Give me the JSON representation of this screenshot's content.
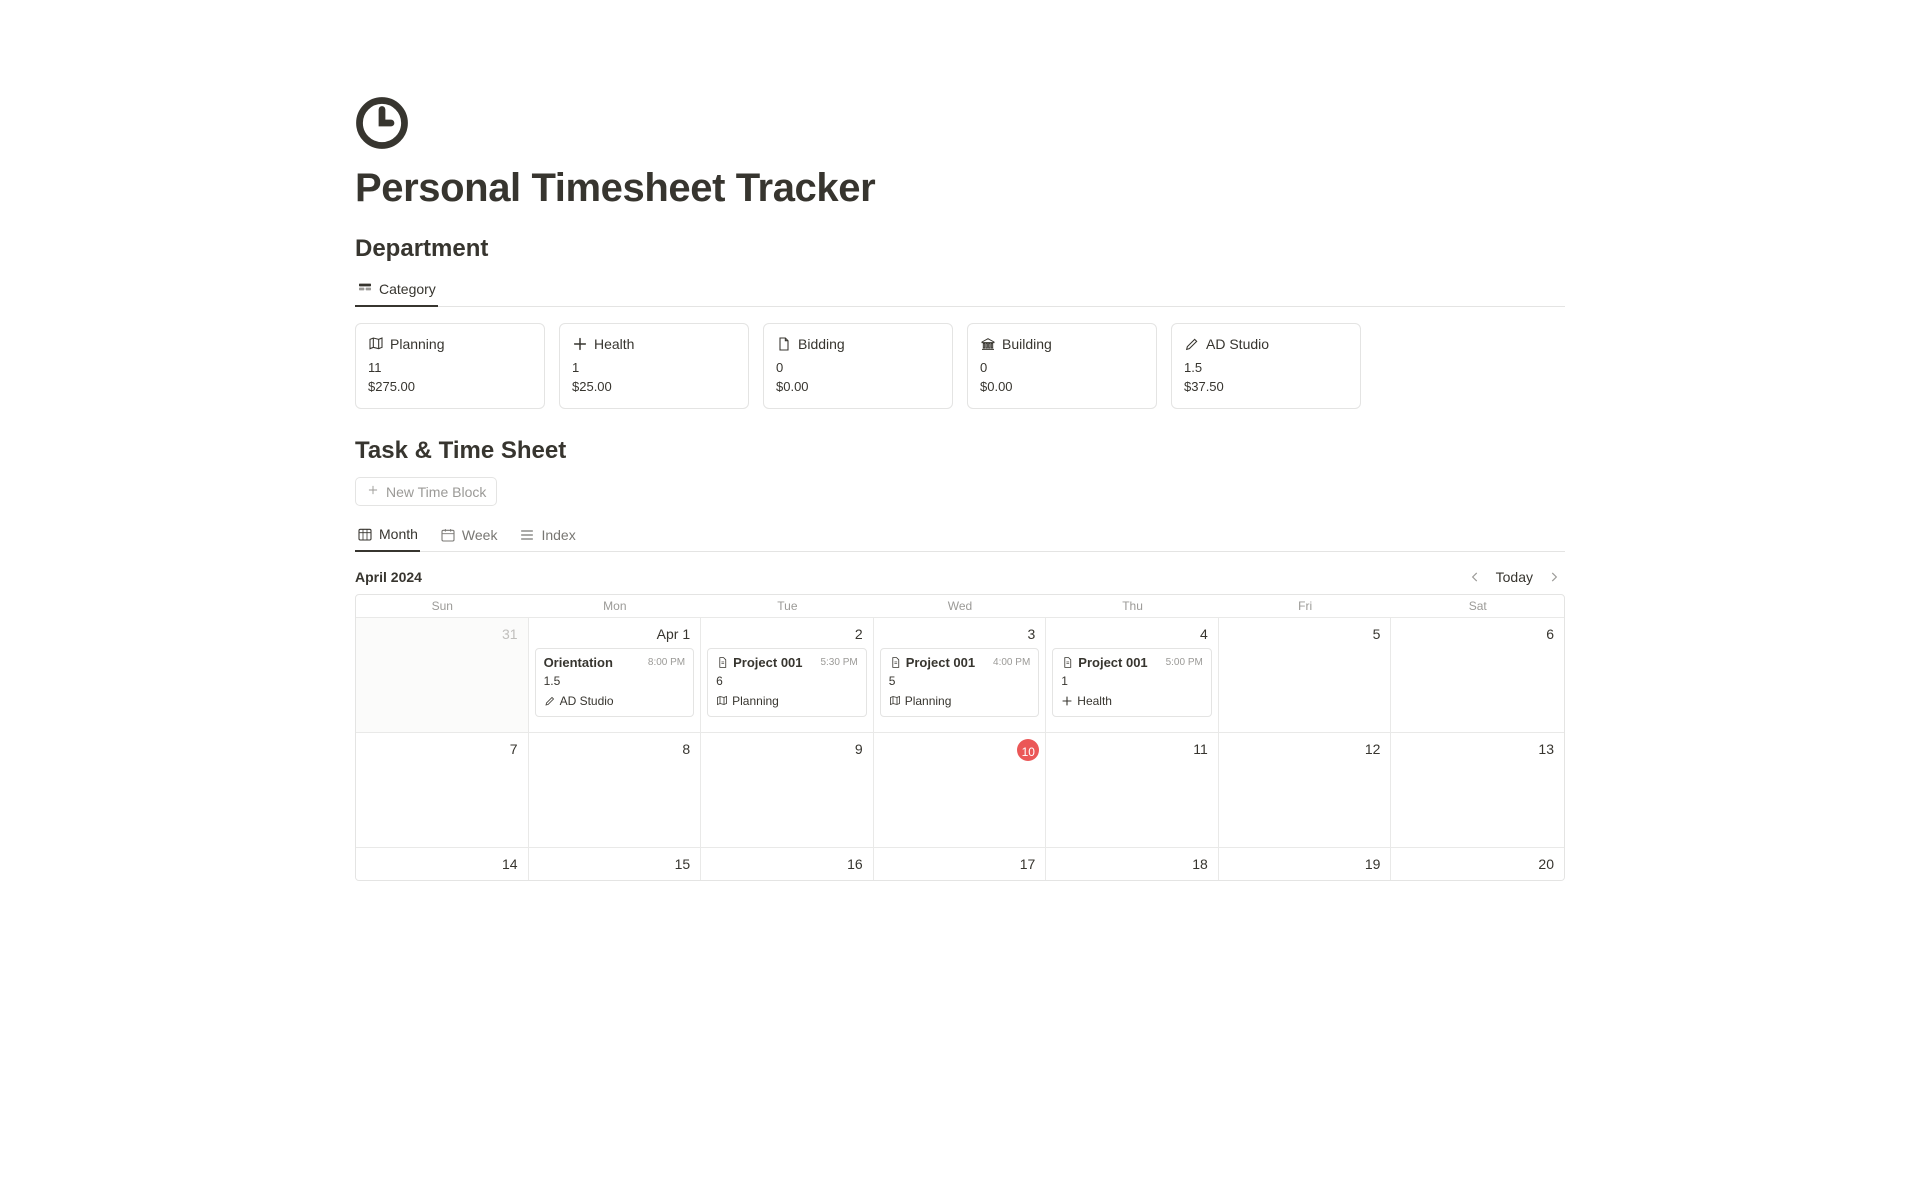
{
  "pageTitle": "Personal Timesheet Tracker",
  "section1": {
    "title": "Department",
    "tab": "Category"
  },
  "cards": [
    {
      "icon": "map",
      "name": "Planning",
      "hours": "11",
      "amount": "$275.00"
    },
    {
      "icon": "plus",
      "name": "Health",
      "hours": "1",
      "amount": "$25.00"
    },
    {
      "icon": "file",
      "name": "Bidding",
      "hours": "0",
      "amount": "$0.00"
    },
    {
      "icon": "bank",
      "name": "Building",
      "hours": "0",
      "amount": "$0.00"
    },
    {
      "icon": "pencil",
      "name": "AD Studio",
      "hours": "1.5",
      "amount": "$37.50"
    }
  ],
  "section2": {
    "title": "Task & Time Sheet",
    "newBtn": "New Time Block"
  },
  "calTabs": [
    {
      "icon": "cal-grid",
      "label": "Month",
      "active": true
    },
    {
      "icon": "cal-week",
      "label": "Week",
      "active": false
    },
    {
      "icon": "list",
      "label": "Index",
      "active": false
    }
  ],
  "calendar": {
    "month": "April 2024",
    "today": "Today",
    "dow": [
      "Sun",
      "Mon",
      "Tue",
      "Wed",
      "Thu",
      "Fri",
      "Sat"
    ],
    "row1": {
      "dates": [
        "31",
        "Apr 1",
        "2",
        "3",
        "4",
        "5",
        "6"
      ],
      "otherMonth": [
        true,
        false,
        false,
        false,
        false,
        false,
        false
      ],
      "events": {
        "1": {
          "title": "Orientation",
          "time": "8:00 PM",
          "hours": "1.5",
          "tagIcon": "pencil",
          "tag": "AD Studio",
          "doc": false
        },
        "2": {
          "title": "Project 001",
          "time": "5:30 PM",
          "hours": "6",
          "tagIcon": "map",
          "tag": "Planning",
          "doc": true
        },
        "3": {
          "title": "Project 001",
          "time": "4:00 PM",
          "hours": "5",
          "tagIcon": "map",
          "tag": "Planning",
          "doc": true
        },
        "4": {
          "title": "Project 001",
          "time": "5:00 PM",
          "hours": "1",
          "tagIcon": "plus",
          "tag": "Health",
          "doc": true
        }
      }
    },
    "row2": {
      "dates": [
        "7",
        "8",
        "9",
        "10",
        "11",
        "12",
        "13"
      ],
      "todayIndex": 3
    },
    "row3": {
      "dates": [
        "14",
        "15",
        "16",
        "17",
        "18",
        "19",
        "20"
      ]
    }
  }
}
